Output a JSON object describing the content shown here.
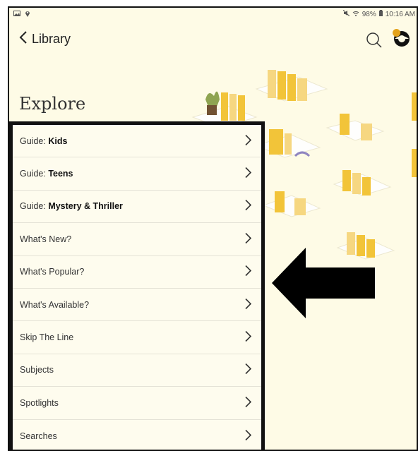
{
  "status_bar": {
    "battery": "98%",
    "time": "10:16 AM"
  },
  "header": {
    "back_label": "Library"
  },
  "page_title": "Explore",
  "menu_items": [
    {
      "prefix": "Guide: ",
      "label": "Kids"
    },
    {
      "prefix": "Guide: ",
      "label": "Teens"
    },
    {
      "prefix": "Guide: ",
      "label": "Mystery & Thriller"
    },
    {
      "prefix": "",
      "label": "What's New?"
    },
    {
      "prefix": "",
      "label": "What's Popular?"
    },
    {
      "prefix": "",
      "label": "What's Available?"
    },
    {
      "prefix": "",
      "label": "Skip The Line"
    },
    {
      "prefix": "",
      "label": "Subjects"
    },
    {
      "prefix": "",
      "label": "Spotlights"
    },
    {
      "prefix": "",
      "label": "Searches"
    }
  ],
  "colors": {
    "background": "#fefbe6",
    "accent": "#f2c230",
    "badge": "#e3a21a"
  },
  "icons": [
    "back-chevron-icon",
    "search-icon",
    "profile-icon",
    "chevron-right-icon",
    "arrow-left-pointer"
  ]
}
